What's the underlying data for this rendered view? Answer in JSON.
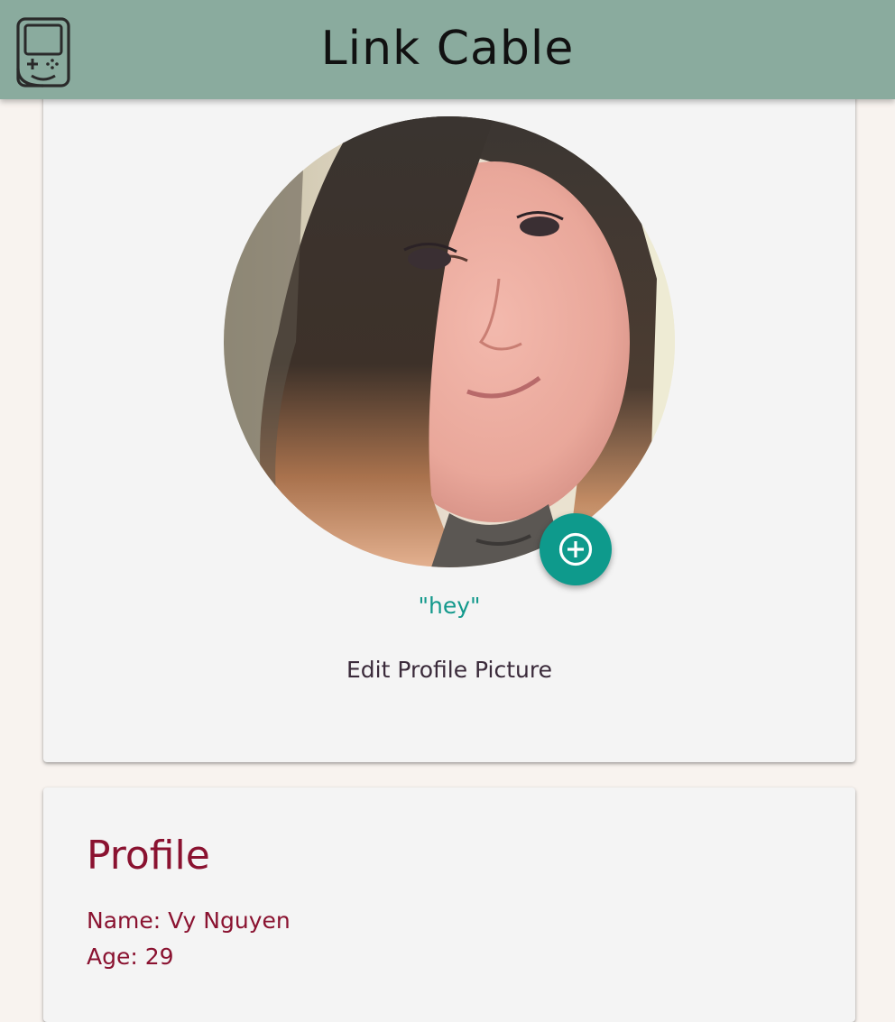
{
  "header": {
    "title": "Link Cable",
    "logo_icon": "gameboy-icon",
    "bar_color": "#8aab9e"
  },
  "photo_card": {
    "status_text": "\"hey\"",
    "edit_label": "Edit Profile Picture",
    "add_button_icon": "add-circle-icon",
    "accent_color": "#0e9a8c"
  },
  "profile_card": {
    "heading": "Profile",
    "name_line": "Name: Vy Nguyen",
    "age_line": "Age: 29",
    "text_color": "#8a1230"
  }
}
